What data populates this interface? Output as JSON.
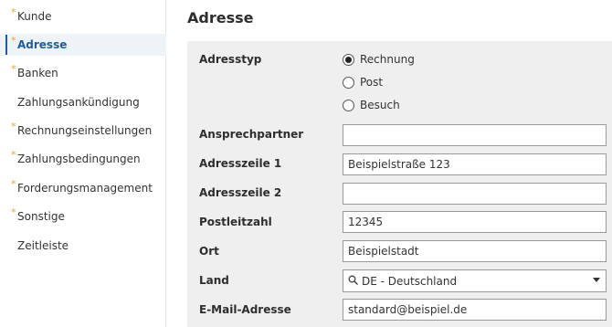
{
  "sidebar": {
    "items": [
      {
        "label": "Kunde",
        "required": true
      },
      {
        "label": "Adresse",
        "required": true,
        "active": true
      },
      {
        "label": "Banken",
        "required": true
      },
      {
        "label": "Zahlungsankündigung",
        "required": false
      },
      {
        "label": "Rechnungseinstellungen",
        "required": true
      },
      {
        "label": "Zahlungsbedingungen",
        "required": true
      },
      {
        "label": "Forderungsmanagement",
        "required": true
      },
      {
        "label": "Sonstige",
        "required": true
      },
      {
        "label": "Zeitleiste",
        "required": false
      }
    ],
    "required_marker": "*",
    "accent_color": "#1f5c99",
    "marker_color": "#e8a33d"
  },
  "main": {
    "title": "Adresse",
    "address_type": {
      "label": "Adresstyp",
      "options": [
        "Rechnung",
        "Post",
        "Besuch"
      ],
      "selected": "Rechnung"
    },
    "contact_person": {
      "label": "Ansprechpartner",
      "value": ""
    },
    "address_line_1": {
      "label": "Adresszeile 1",
      "value": "Beispielstraße 123"
    },
    "address_line_2": {
      "label": "Adresszeile 2",
      "value": ""
    },
    "postal_code": {
      "label": "Postleitzahl",
      "value": "12345"
    },
    "city": {
      "label": "Ort",
      "value": "Beispielstadt"
    },
    "country": {
      "label": "Land",
      "value": "DE - Deutschland",
      "icon": "search-icon"
    },
    "email": {
      "label": "E-Mail-Adresse",
      "value": "standard@beispiel.de"
    }
  }
}
